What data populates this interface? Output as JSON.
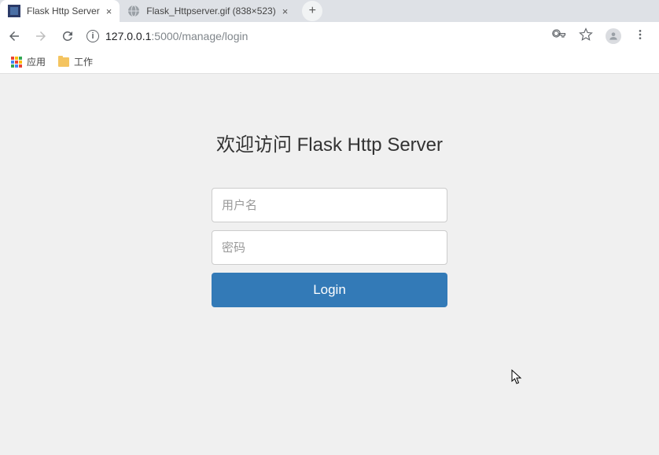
{
  "tabs": [
    {
      "title": "Flask Http Server"
    },
    {
      "title": "Flask_Httpserver.gif (838×523)"
    }
  ],
  "address": {
    "host": "127.0.0.1",
    "path": ":5000/manage/login"
  },
  "bookmarks": {
    "apps": "应用",
    "work": "工作"
  },
  "page": {
    "heading": "欢迎访问 Flask Http Server",
    "username_placeholder": "用户名",
    "password_placeholder": "密码",
    "login_label": "Login"
  }
}
